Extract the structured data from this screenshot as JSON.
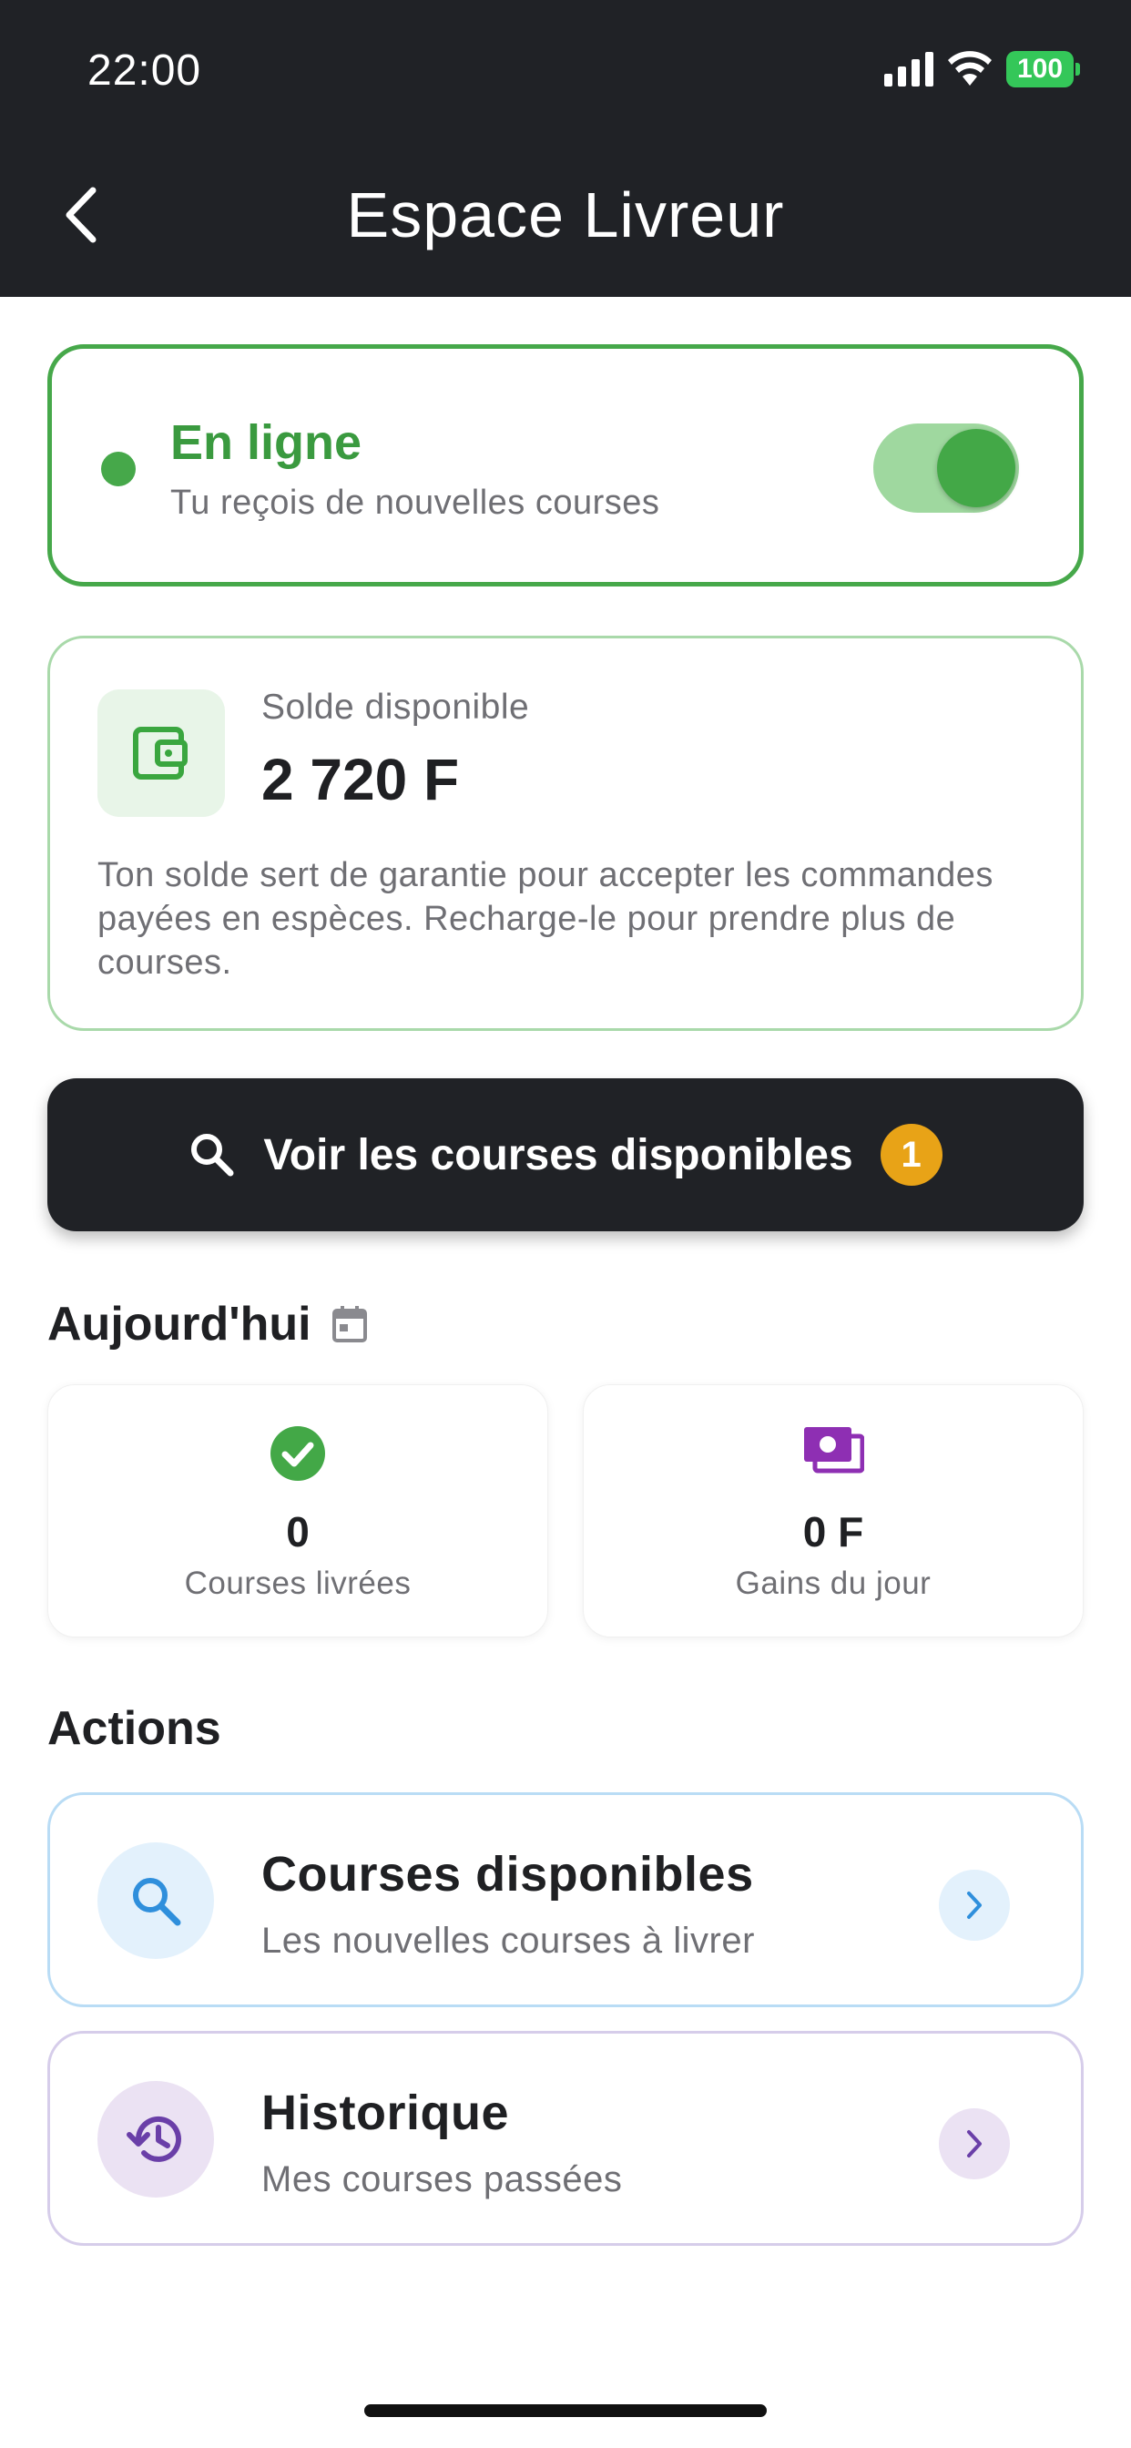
{
  "status_bar": {
    "time": "22:00",
    "battery": "100"
  },
  "header": {
    "title": "Espace Livreur"
  },
  "online_card": {
    "title": "En ligne",
    "subtitle": "Tu reçois de nouvelles courses",
    "toggle_on": true
  },
  "balance_card": {
    "label": "Solde disponible",
    "amount": "2 720 F",
    "description": "Ton solde sert de garantie pour accepter les commandes payées en espèces. Recharge-le pour prendre plus de courses."
  },
  "available_button": {
    "label": "Voir les courses disponibles",
    "badge": "1"
  },
  "today": {
    "title": "Aujourd'hui",
    "stats": [
      {
        "value": "0",
        "label": "Courses livrées",
        "icon": "check-circle-icon"
      },
      {
        "value": "0 F",
        "label": "Gains du jour",
        "icon": "cash-icon"
      }
    ]
  },
  "actions": {
    "title": "Actions",
    "items": [
      {
        "title": "Courses disponibles",
        "subtitle": "Les nouvelles courses à livrer",
        "icon": "search-icon",
        "color": "#2f8fdc"
      },
      {
        "title": "Historique",
        "subtitle": "Mes courses passées",
        "icon": "history-icon",
        "color": "#6a3fa8"
      }
    ]
  },
  "colors": {
    "header_bg": "#202226",
    "online_green": "#46a84a",
    "badge_orange": "#e8a317",
    "cash_purple": "#8e2fb3"
  }
}
